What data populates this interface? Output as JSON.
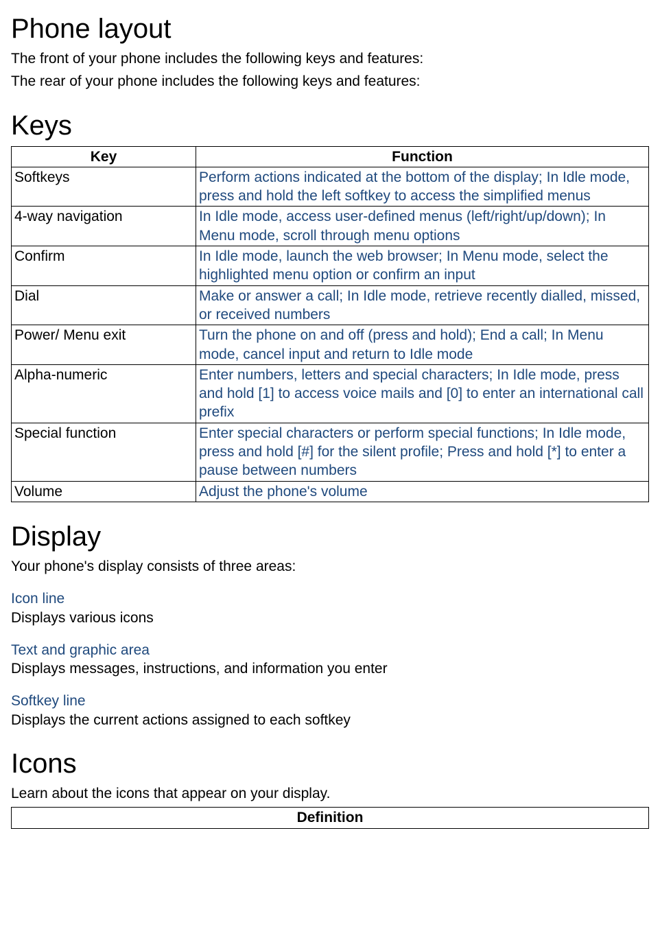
{
  "phone_layout": {
    "heading": "Phone layout",
    "front_text": "The front of your phone includes the following keys and features:",
    "rear_text": "The rear of your phone includes the following keys and features:"
  },
  "keys": {
    "heading": "Keys",
    "header_key": "Key",
    "header_function": "Function",
    "rows": [
      {
        "key": "Softkeys",
        "function": "Perform actions indicated at the bottom of the display; In Idle mode, press and hold the left softkey to access the simplified menus"
      },
      {
        "key": "4-way navigation",
        "function": "In Idle mode, access user-defined menus (left/right/up/down); In Menu mode, scroll through menu options"
      },
      {
        "key": "Confirm",
        "function": "In Idle mode, launch the web browser; In Menu mode, select the highlighted menu option or confirm an input"
      },
      {
        "key": "Dial",
        "function": "Make or answer a call; In Idle mode, retrieve recently dialled, missed, or received numbers"
      },
      {
        "key": "Power/ Menu exit",
        "function": "Turn the phone on and off (press and hold); End a call; In Menu mode, cancel input and return to Idle mode"
      },
      {
        "key": "Alpha-numeric",
        "function": "Enter numbers, letters and special characters; In Idle mode, press and hold [1] to access voice mails and [0] to enter an international call prefix"
      },
      {
        "key": "Special function",
        "function": "Enter special characters or perform special functions; In Idle mode, press and hold [#] for the silent profile; Press and hold [*] to enter a pause between numbers"
      },
      {
        "key": "Volume",
        "function": "Adjust the phone's volume"
      }
    ]
  },
  "display": {
    "heading": "Display",
    "intro": "Your phone's display consists of three areas:",
    "areas": [
      {
        "label": "Icon line",
        "desc": "Displays various icons"
      },
      {
        "label": "Text and graphic area",
        "desc": "Displays messages, instructions, and information you enter"
      },
      {
        "label": "Softkey line",
        "desc": "Displays the current actions assigned to each softkey"
      }
    ]
  },
  "icons": {
    "heading": "Icons",
    "intro": "Learn about the icons that appear on your display.",
    "header_definition": "Definition"
  }
}
